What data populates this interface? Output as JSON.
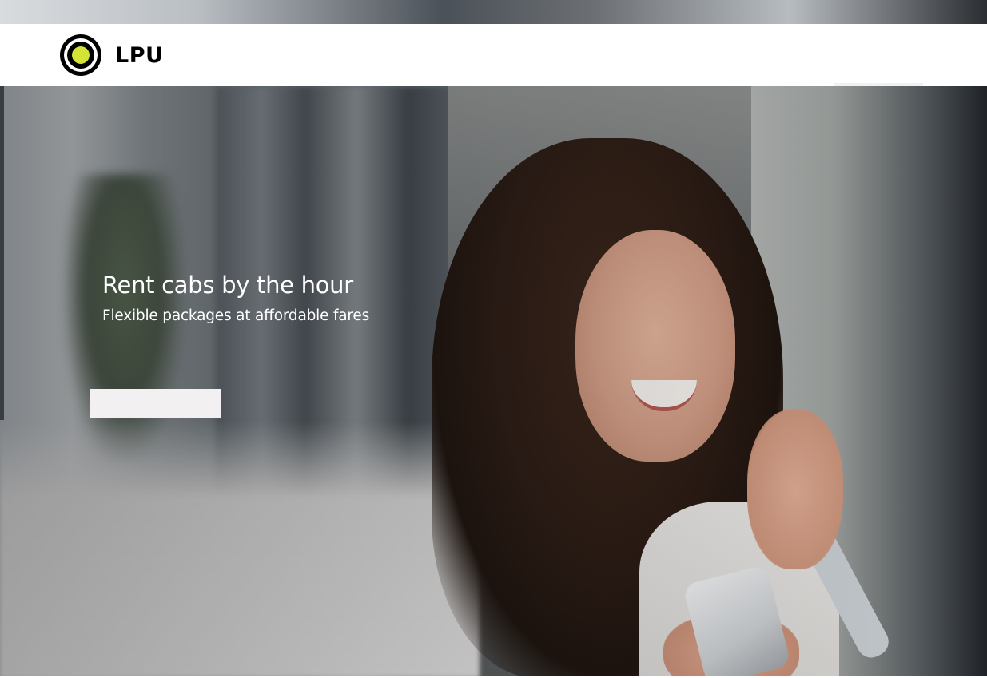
{
  "header": {
    "brand_name": "LPU",
    "logo_icon": "logo-circle-icon",
    "logo_color": "#d4e436"
  },
  "hero": {
    "title": "Rent cabs by the hour",
    "subtitle": "Flexible packages at affordable fares",
    "cta_label": "",
    "background_image": "woman smiling at phone on city street"
  },
  "colors": {
    "text_on_hero": "#ffffff",
    "nav_background": "#ffffff",
    "brand_text": "#000000",
    "accent": "#d4e436"
  }
}
